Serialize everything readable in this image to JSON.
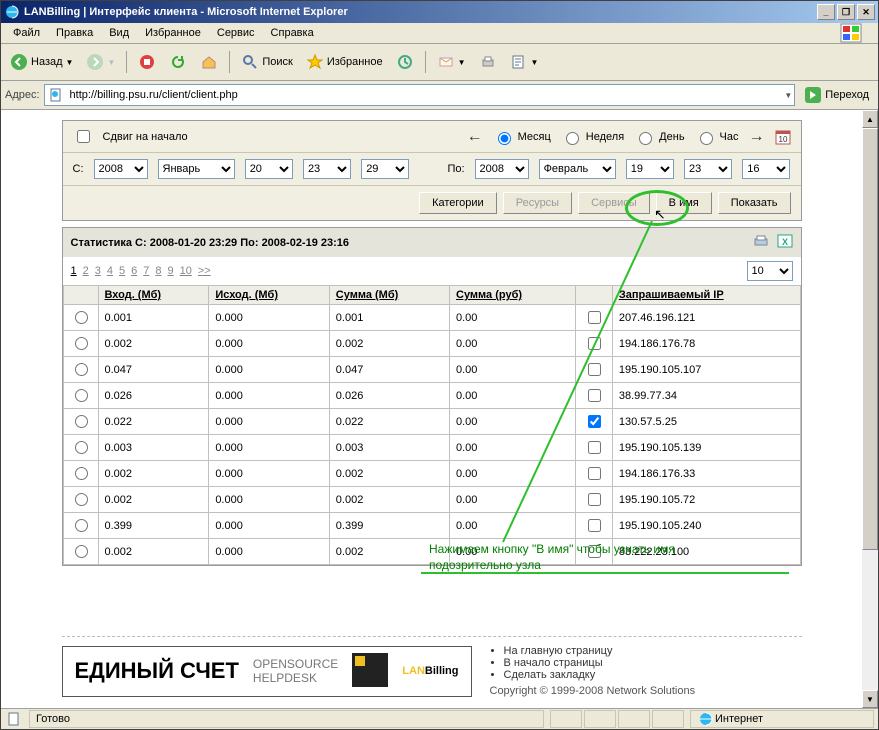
{
  "window": {
    "title": "LANBilling | Интерфейс клиента - Microsoft Internet Explorer"
  },
  "menu": {
    "file": "Файл",
    "edit": "Правка",
    "view": "Вид",
    "favorites": "Избранное",
    "service": "Сервис",
    "help": "Справка"
  },
  "toolbar": {
    "back": "Назад",
    "search": "Поиск",
    "favorites": "Избранное"
  },
  "addressbar": {
    "label": "Адрес:",
    "url": "http://billing.psu.ru/client/client.php",
    "go": "Переход"
  },
  "filter": {
    "shift_start": "Сдвиг на начало",
    "period": {
      "month": "Месяц",
      "week": "Неделя",
      "day": "День",
      "hour": "Час"
    },
    "from_label": "С:",
    "to_label": "По:",
    "from": {
      "year": "2008",
      "month": "Январь",
      "day": "20",
      "hour": "23",
      "minute": "29"
    },
    "to": {
      "year": "2008",
      "month": "Февраль",
      "day": "19",
      "hour": "23",
      "minute": "16"
    }
  },
  "buttons": {
    "categories": "Категории",
    "resources": "Ресурсы",
    "services": "Сервисы",
    "to_name": "В имя",
    "show": "Показать"
  },
  "stat": {
    "title": "Статистика С: 2008-01-20 23:29 По: 2008-02-19 23:16",
    "pages": [
      "1",
      "2",
      "3",
      "4",
      "5",
      "6",
      "7",
      "8",
      "9",
      "10",
      ">>"
    ],
    "per_page": "10",
    "columns": {
      "in": "Вход. (Мб)",
      "out": "Исход. (Мб)",
      "summb": "Сумма (Мб)",
      "sumrub": "Сумма (руб)",
      "ip": "Запрашиваемый IP"
    },
    "rows": [
      {
        "in": "0.001",
        "out": "0.000",
        "summb": "0.001",
        "sumrub": "0.00",
        "chk": false,
        "ip": "207.46.196.121"
      },
      {
        "in": "0.002",
        "out": "0.000",
        "summb": "0.002",
        "sumrub": "0.00",
        "chk": false,
        "ip": "194.186.176.78"
      },
      {
        "in": "0.047",
        "out": "0.000",
        "summb": "0.047",
        "sumrub": "0.00",
        "chk": false,
        "ip": "195.190.105.107"
      },
      {
        "in": "0.026",
        "out": "0.000",
        "summb": "0.026",
        "sumrub": "0.00",
        "chk": false,
        "ip": "38.99.77.34"
      },
      {
        "in": "0.022",
        "out": "0.000",
        "summb": "0.022",
        "sumrub": "0.00",
        "chk": true,
        "ip": "130.57.5.25"
      },
      {
        "in": "0.003",
        "out": "0.000",
        "summb": "0.003",
        "sumrub": "0.00",
        "chk": false,
        "ip": "195.190.105.139"
      },
      {
        "in": "0.002",
        "out": "0.000",
        "summb": "0.002",
        "sumrub": "0.00",
        "chk": false,
        "ip": "194.186.176.33"
      },
      {
        "in": "0.002",
        "out": "0.000",
        "summb": "0.002",
        "sumrub": "0.00",
        "chk": false,
        "ip": "195.190.105.72"
      },
      {
        "in": "0.399",
        "out": "0.000",
        "summb": "0.399",
        "sumrub": "0.00",
        "chk": false,
        "ip": "195.190.105.240"
      },
      {
        "in": "0.002",
        "out": "0.000",
        "summb": "0.002",
        "sumrub": "0.00",
        "chk": false,
        "ip": "83.222.23.100"
      }
    ]
  },
  "annotation": {
    "line1": "Нажимаем кнопку \"В имя\" чтобы узнать имя",
    "line2": "подозрительно узла"
  },
  "footer": {
    "promo_title": "ЕДИНЫЙ СЧЕТ",
    "promo_sub1": "OPENSOURCE",
    "promo_sub2": "HELPDESK",
    "promo_brand": "LANBilling",
    "links": [
      "На главную страницу",
      "В начало страницы",
      "Сделать закладку"
    ],
    "copyright": "Copyright © 1999-2008 Network Solutions"
  },
  "statusbar": {
    "ready": "Готово",
    "zone": "Интернет"
  }
}
